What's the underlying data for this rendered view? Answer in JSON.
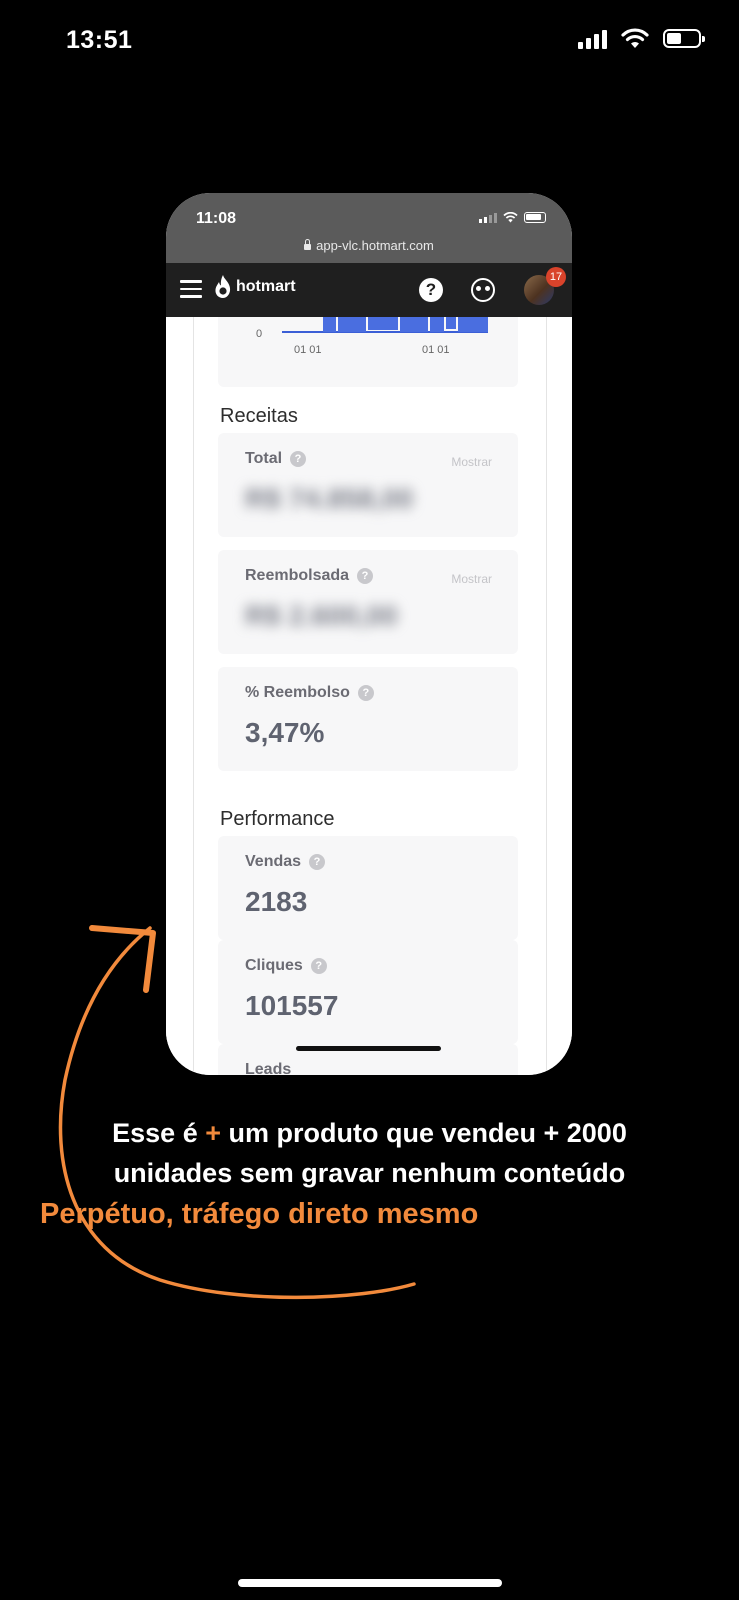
{
  "os_status": {
    "time": "13:51"
  },
  "phone": {
    "time": "11:08",
    "url": "app-vlc.hotmart.com",
    "brand": "hotmart",
    "help_icon": "?",
    "notification_count": "17",
    "chart": {
      "y_tick": "0",
      "x_ticks": [
        "01 01",
        "01 01"
      ]
    },
    "sections": {
      "receitas": "Receitas",
      "performance": "Performance"
    },
    "cards": {
      "total": {
        "label": "Total",
        "toggle": "Mostrar",
        "value": "R$ 74.858,00"
      },
      "reembolsada": {
        "label": "Reembolsada",
        "toggle": "Mostrar",
        "value": "R$ 2.600,00"
      },
      "reembolso": {
        "label": "% Reembolso",
        "value": "3,47%"
      },
      "vendas": {
        "label": "Vendas",
        "value": "2183"
      },
      "cliques": {
        "label": "Cliques",
        "value": "101557"
      },
      "leads": {
        "label": "Leads"
      }
    }
  },
  "caption": {
    "line1_a": "Esse é ",
    "line1_plus": "+",
    "line1_b": " um produto que vendeu + 2000",
    "line2": "unidades sem gravar nenhum conteúdo",
    "line3": "Perpétuo, tráfego direto mesmo"
  },
  "colors": {
    "accent": "#f28a3c",
    "chart_bar": "#4a6ee0",
    "badge": "#d9432b"
  }
}
